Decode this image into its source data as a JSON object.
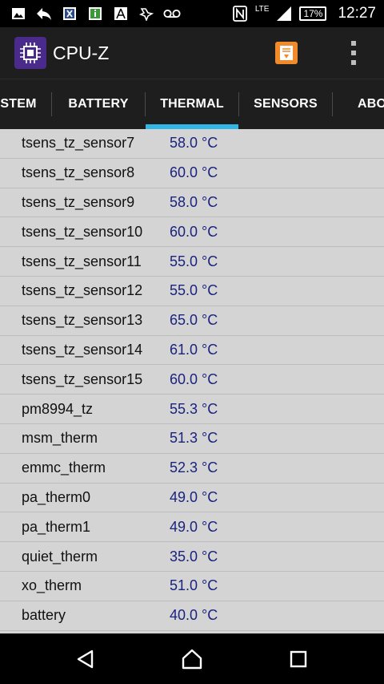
{
  "status_bar": {
    "time": "12:27",
    "battery": "17%",
    "network": "LTE",
    "icons": [
      "gallery-icon",
      "reply-icon",
      "excel-icon",
      "info-app-icon",
      "acrobat-icon",
      "game-icon",
      "voicemail-icon",
      "nfc-icon",
      "signal-icon"
    ]
  },
  "app_bar": {
    "title": "CPU-Z",
    "colors": {
      "background": "#1e1e1e",
      "action": "#f08a2a",
      "logo": "#4a2a8a"
    }
  },
  "tabs": {
    "items": [
      {
        "label": "STEM"
      },
      {
        "label": "BATTERY"
      },
      {
        "label": "THERMAL",
        "active": true
      },
      {
        "label": "SENSORS"
      },
      {
        "label": "ABO"
      }
    ],
    "indicator_color": "#33b5e5"
  },
  "thermal": {
    "rows": [
      {
        "name": "tsens_tz_sensor7",
        "value": "58.0 °C"
      },
      {
        "name": "tsens_tz_sensor8",
        "value": "60.0 °C"
      },
      {
        "name": "tsens_tz_sensor9",
        "value": "58.0 °C"
      },
      {
        "name": "tsens_tz_sensor10",
        "value": "60.0 °C"
      },
      {
        "name": "tsens_tz_sensor11",
        "value": "55.0 °C"
      },
      {
        "name": "tsens_tz_sensor12",
        "value": "55.0 °C"
      },
      {
        "name": "tsens_tz_sensor13",
        "value": "65.0 °C"
      },
      {
        "name": "tsens_tz_sensor14",
        "value": "61.0 °C"
      },
      {
        "name": "tsens_tz_sensor15",
        "value": "60.0 °C"
      },
      {
        "name": "pm8994_tz",
        "value": "55.3 °C"
      },
      {
        "name": "msm_therm",
        "value": "51.3 °C"
      },
      {
        "name": "emmc_therm",
        "value": "52.3 °C"
      },
      {
        "name": "pa_therm0",
        "value": "49.0 °C"
      },
      {
        "name": "pa_therm1",
        "value": "49.0 °C"
      },
      {
        "name": "quiet_therm",
        "value": "35.0 °C"
      },
      {
        "name": "xo_therm",
        "value": "51.0 °C"
      },
      {
        "name": "battery",
        "value": "40.0 °C"
      }
    ],
    "value_color": "#1a237e"
  },
  "nav_bar": {
    "buttons": [
      "back-icon",
      "home-icon",
      "recents-icon"
    ]
  }
}
